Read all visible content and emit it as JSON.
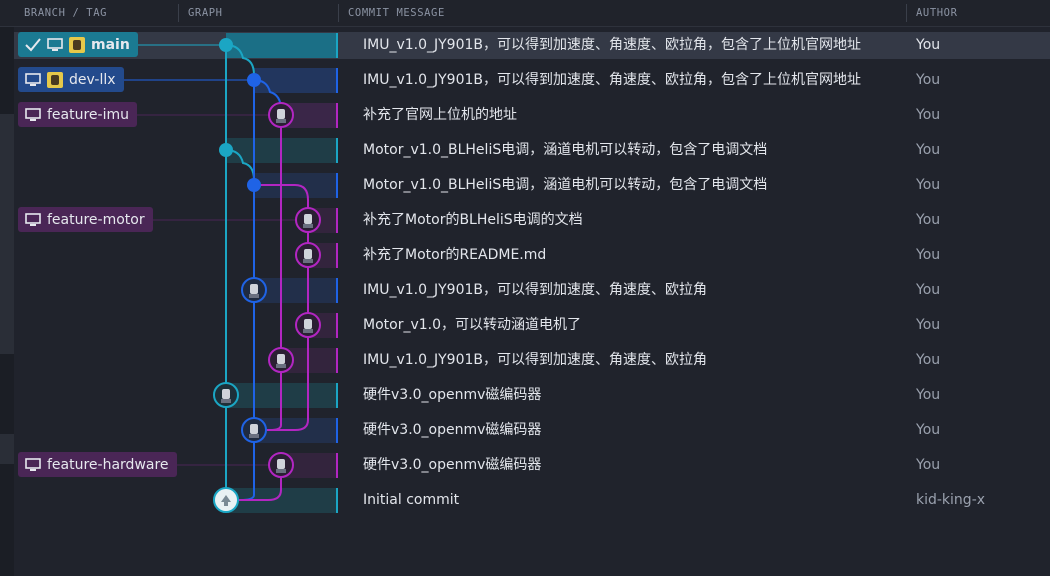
{
  "header": {
    "branch_tag": "BRANCH / TAG",
    "graph": "GRAPH",
    "commit_message": "COMMIT MESSAGE",
    "author": "AUTHOR"
  },
  "labels": {
    "main": "main",
    "dev_llx": "dev-llx",
    "feature_imu": "feature-imu",
    "feature_motor": "feature-motor",
    "feature_hardware": "feature-hardware"
  },
  "commits": [
    {
      "message": "IMU_v1.0_JY901B，可以得到加速度、角速度、欧拉角，包含了上位机官网地址",
      "author": "You"
    },
    {
      "message": "IMU_v1.0_JY901B，可以得到加速度、角速度、欧拉角，包含了上位机官网地址",
      "author": "You"
    },
    {
      "message": "补充了官网上位机的地址",
      "author": "You"
    },
    {
      "message": "Motor_v1.0_BLHeliS电调，涵道电机可以转动，包含了电调文档",
      "author": "You"
    },
    {
      "message": "Motor_v1.0_BLHeliS电调，涵道电机可以转动，包含了电调文档",
      "author": "You"
    },
    {
      "message": "补充了Motor的BLHeliS电调的文档",
      "author": "You"
    },
    {
      "message": "补充了Motor的README.md",
      "author": "You"
    },
    {
      "message": "IMU_v1.0_JY901B，可以得到加速度、角速度、欧拉角",
      "author": "You"
    },
    {
      "message": "Motor_v1.0，可以转动涵道电机了",
      "author": "You"
    },
    {
      "message": "IMU_v1.0_JY901B，可以得到加速度、角速度、欧拉角",
      "author": "You"
    },
    {
      "message": "硬件v3.0_openmv磁编码器",
      "author": "You"
    },
    {
      "message": "硬件v3.0_openmv磁编码器",
      "author": "You"
    },
    {
      "message": "硬件v3.0_openmv磁编码器",
      "author": "You"
    },
    {
      "message": "Initial commit",
      "author": "kid-king-x"
    }
  ],
  "colors": {
    "main": "#1ba6c4",
    "dev": "#1f63e6",
    "purple": "#b226c2",
    "main_label": "#1b7a92",
    "dev_label": "#234a8c",
    "feature_label": "#4a2656"
  }
}
